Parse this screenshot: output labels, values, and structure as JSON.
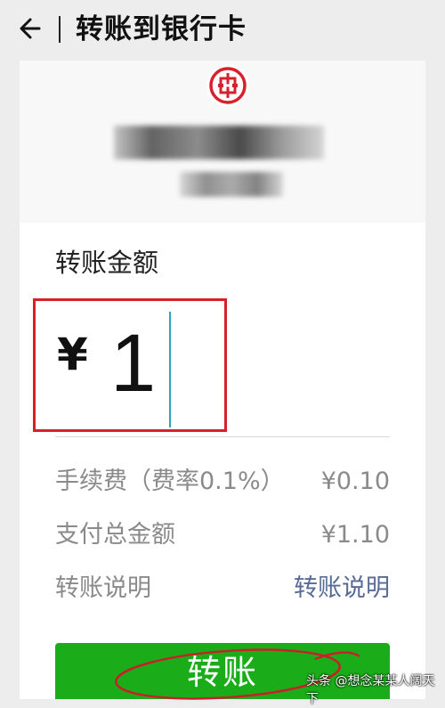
{
  "header": {
    "title": "转账到银行卡"
  },
  "bank": {
    "logo_name": "bank-logo",
    "accent": "#d8202c"
  },
  "form": {
    "amount_label": "转账金额",
    "currency_symbol": "¥",
    "amount_value": "1",
    "fee_label": "手续费（费率0.1%）",
    "fee_value": "¥0.10",
    "total_label": "支付总金额",
    "total_value": "¥1.10",
    "note_label": "转账说明",
    "note_link": "转账说明"
  },
  "actions": {
    "submit_label": "转账",
    "button_color": "#1aad19"
  },
  "watermark": {
    "text": "头条 @想念某某人阔天下"
  }
}
